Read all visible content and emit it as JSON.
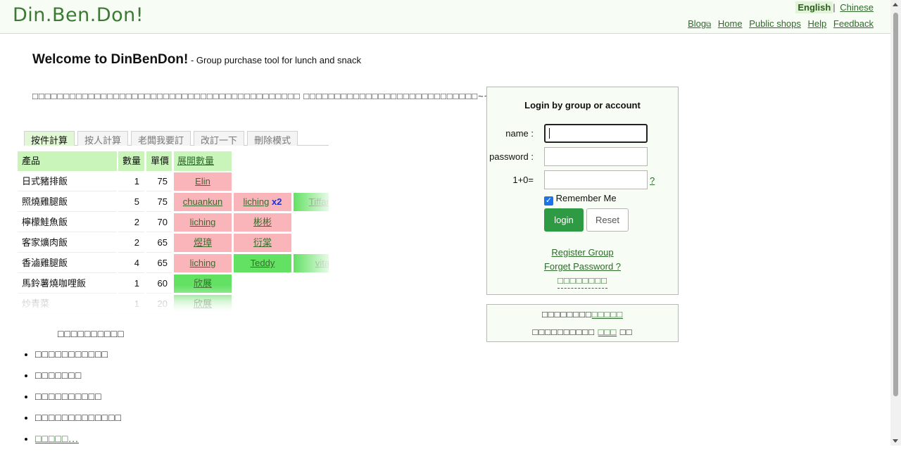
{
  "header": {
    "logo": "Din.Ben.Don!",
    "lang_current": "English",
    "lang_sep": "|",
    "lang_other": "Chinese",
    "nav": {
      "blog": "Blog",
      "blog_icon": "external-link-icon",
      "home": "Home",
      "public_shops": "Public shops",
      "help": "Help",
      "feedback": "Feedback"
    }
  },
  "welcome": {
    "title": "Welcome to DinBenDon!",
    "subtitle": " - Group purchase tool for lunch and snack",
    "intro": "□□□□□□□□□□□□□□□□□□□□□□□□□□□□□□□□□□□□□□□□□□□ □□□□□□□□□□□□□□□□□□□□□□□□□□□□~~"
  },
  "tabs": [
    "按件計算",
    "按人計算",
    "老闆我要訂",
    "改訂一下",
    "刪除模式"
  ],
  "table": {
    "headers": {
      "product": "產品",
      "qty": "數量",
      "price": "單價",
      "expand": "展開數量"
    },
    "rows": [
      {
        "product": "日式豬排飯",
        "qty": "1",
        "price": "75",
        "people": [
          {
            "name": "Elin",
            "color": "pink"
          }
        ]
      },
      {
        "product": "照燒雞腿飯",
        "qty": "5",
        "price": "75",
        "people": [
          {
            "name": "chuankun",
            "color": "pink"
          },
          {
            "name": "liching",
            "extra": "x2",
            "color": "pink"
          },
          {
            "name": "Tiffany",
            "color": "green"
          }
        ]
      },
      {
        "product": "檸檬鮭魚飯",
        "qty": "2",
        "price": "70",
        "people": [
          {
            "name": "liching",
            "color": "pink"
          },
          {
            "name": "彬彬",
            "color": "pink"
          }
        ]
      },
      {
        "product": "客家爌肉飯",
        "qty": "2",
        "price": "65",
        "people": [
          {
            "name": "煜璋",
            "color": "pink"
          },
          {
            "name": "衍棠",
            "color": "pink"
          }
        ]
      },
      {
        "product": "香滷雞腿飯",
        "qty": "4",
        "price": "65",
        "people": [
          {
            "name": "liching",
            "color": "pink"
          },
          {
            "name": "Teddy",
            "color": "green"
          },
          {
            "name": "vita",
            "color": "green"
          }
        ]
      },
      {
        "product": "馬鈴薯燒咖哩飯",
        "qty": "1",
        "price": "60",
        "people": [
          {
            "name": "欣展",
            "color": "green"
          }
        ]
      },
      {
        "product": "炒青菜",
        "qty": "1",
        "price": "20",
        "people": [
          {
            "name": "欣展",
            "color": "fadegreen"
          }
        ]
      }
    ]
  },
  "more": {
    "title": "□□□□□□□□□□",
    "items": [
      "□□□□□□□□□□□",
      "□□□□□□□",
      "□□□□□□□□□□",
      "□□□□□□□□□□□□□"
    ],
    "link": "□□□□□..."
  },
  "login": {
    "title": "Login by group or account",
    "name_label": "name :",
    "password_label": "password :",
    "captcha_label": "1+0=",
    "captcha_help": "?",
    "remember": "Remember Me",
    "login_btn": "login",
    "reset_btn": "Reset",
    "register": "Register Group",
    "forget": "Forget Password ?",
    "other": "□□□□□□□□"
  },
  "info": {
    "line1_text": "□□□□□□□□",
    "line1_link": "□□□□□",
    "line2_text": "□□□□□□□□□□ ",
    "line2_link": "□□□",
    "line2_end": " □□"
  },
  "colors": {
    "accent": "#2f9a44",
    "pink": "#f9b5b9",
    "green": "#63e163",
    "header_bg": "#c9f5bb"
  }
}
